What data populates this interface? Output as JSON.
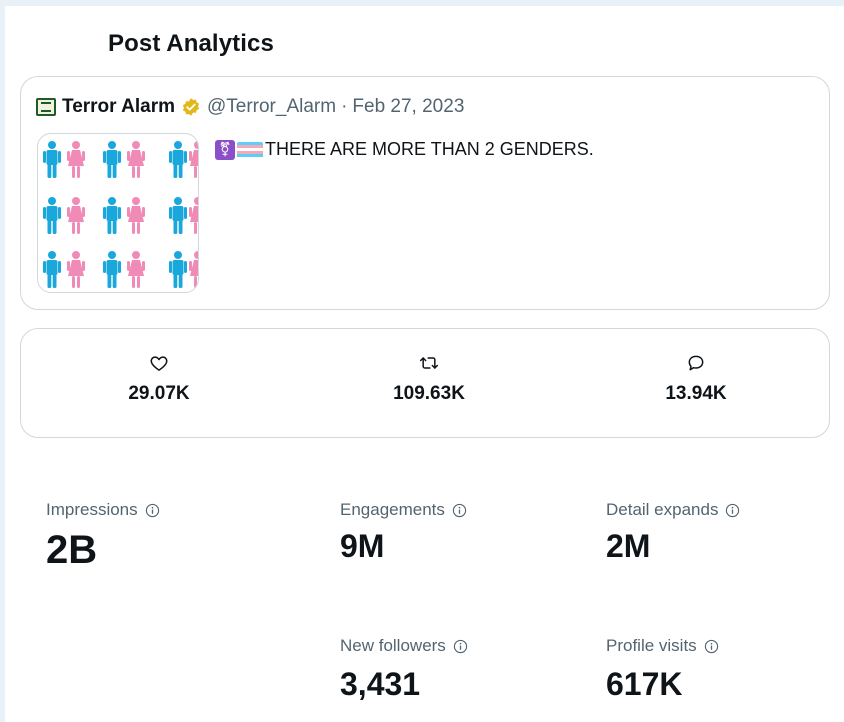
{
  "page": {
    "title": "Post Analytics"
  },
  "tweet": {
    "author": "Terror Alarm",
    "handle": "@Terror_Alarm",
    "separator": "·",
    "date": "Feb 27, 2023",
    "text": "THERE ARE MORE THAN 2 GENDERS.",
    "emoji_symbol": "⚧"
  },
  "metrics": {
    "likes": "29.07K",
    "reposts": "109.63K",
    "replies": "13.94K"
  },
  "stats": {
    "impressions": {
      "label": "Impressions",
      "value": "2B"
    },
    "engagements": {
      "label": "Engagements",
      "value": "9M"
    },
    "detail_expands": {
      "label": "Detail expands",
      "value": "2M"
    },
    "new_followers": {
      "label": "New followers",
      "value": "3,431"
    },
    "profile_visits": {
      "label": "Profile visits",
      "value": "617K"
    }
  },
  "icons": {
    "like": "heart-icon",
    "repost": "repost-icon",
    "reply": "reply-icon",
    "verified": "verified-badge-icon",
    "info": "info-icon"
  },
  "colors": {
    "verified_gold": "#e2b719",
    "border": "#cfd9de",
    "muted_text": "#536471",
    "figure_blue": "#1aa7dc",
    "figure_pink": "#f08bb8"
  }
}
